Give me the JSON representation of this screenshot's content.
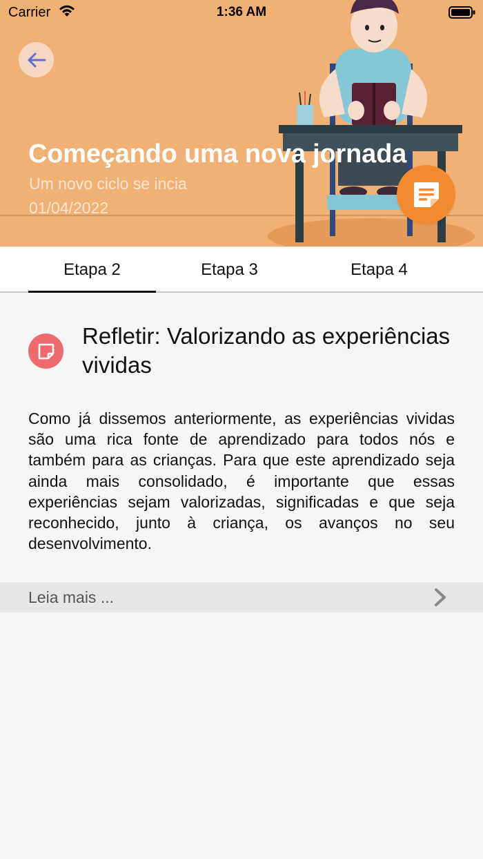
{
  "status_bar": {
    "carrier": "Carrier",
    "time": "1:36 AM",
    "icons": [
      "wifi-icon",
      "battery-icon"
    ]
  },
  "header": {
    "back_icon": "arrow-left-icon",
    "title": "Começando uma nova jornada",
    "subtitle": "Um novo ciclo se incia",
    "date": "01/04/2022",
    "notes_icon": "notes-icon",
    "background_color": "#f2b174",
    "accent_color": "#f28a2f"
  },
  "tabs": [
    {
      "label": "Etapa 2",
      "selected": true
    },
    {
      "label": "Etapa 3",
      "selected": false
    },
    {
      "label": "Etapa 4",
      "selected": false
    }
  ],
  "section": {
    "icon": "note-icon",
    "icon_color": "#ef6a6e",
    "title": "Refletir: Valorizando as experiências vividas",
    "body": "Como já dissemos anteriormente, as experiências vividas são uma rica fonte de aprendizado para todos nós e também para as crianças. Para que este aprendizado seja ainda mais consolidado, é importante que essas experiências sejam valorizadas, significadas e que seja reconhecido, junto à criança, os avanços no seu desenvolvimento."
  },
  "read_more": {
    "label": "Leia mais ...",
    "icon": "chevron-right-icon"
  }
}
